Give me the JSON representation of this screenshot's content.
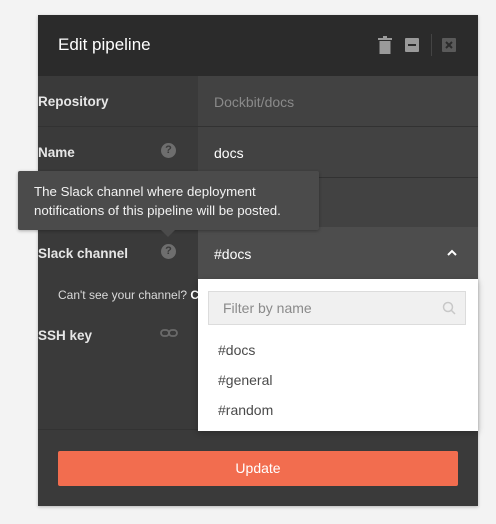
{
  "modal": {
    "title": "Edit pipeline",
    "header_icons": [
      "trash-icon",
      "minimize-icon",
      "close-icon"
    ]
  },
  "form": {
    "repository": {
      "label": "Repository",
      "value": "Dockbit/docs"
    },
    "name": {
      "label": "Name",
      "value": "docs",
      "help_icon": "question-icon"
    },
    "slack": {
      "label": "Slack channel",
      "value": "#docs",
      "help_icon": "question-icon",
      "help_text_line1": "The Slack channel where deployment",
      "help_text_line2": "notifications of this pipeline will be posted.",
      "cant_see": "Can't see your channel?",
      "cant_see_link": "C"
    },
    "ssh": {
      "label": "SSH key",
      "icon": "link-icon"
    }
  },
  "dropdown": {
    "placeholder": "Filter by name",
    "options": [
      "#docs",
      "#general",
      "#random"
    ]
  },
  "actions": {
    "update_label": "Update"
  },
  "colors": {
    "accent": "#f26d4f",
    "modal_bg": "#3a3a3a",
    "header_bg": "#2b2b2b"
  }
}
